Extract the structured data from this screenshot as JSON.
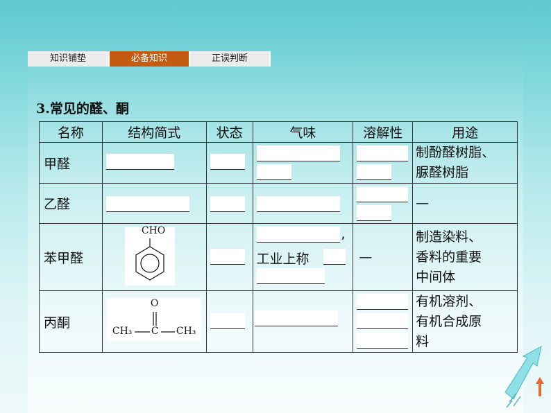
{
  "tabs": [
    {
      "label": "知识铺垫",
      "active": false
    },
    {
      "label": "必备知识",
      "active": true
    },
    {
      "label": "正误判断",
      "active": false
    }
  ],
  "heading": "3.常见的醛、酮",
  "table": {
    "headers": [
      "名称",
      "结构简式",
      "状态",
      "气味",
      "溶解性",
      "用途"
    ],
    "rows": [
      {
        "name": "甲醛",
        "use": [
          "制酚醛树脂、",
          "脲醛树脂"
        ],
        "sol": ""
      },
      {
        "name": "乙醛",
        "use": [
          "—"
        ],
        "sol": ""
      },
      {
        "name": "苯甲醛",
        "use": [
          "制造染料、",
          "香料的重要",
          "中间体"
        ],
        "odor_mid": "工业上称",
        "odor_comma": ",",
        "sol": "—"
      },
      {
        "name": "丙酮",
        "use": [
          "有机溶剂、",
          "有机合成原",
          "料"
        ],
        "sol": ""
      }
    ],
    "benzaldehyde_label": "CHO",
    "acetone_o": "O",
    "acetone_ch3_left": "CH₃",
    "acetone_c": "C",
    "acetone_ch3_right": "CH₃"
  },
  "colors": {
    "accent": "#c55a11",
    "tab_bg": "#ececec",
    "bg_top": "#5ec9cf"
  }
}
